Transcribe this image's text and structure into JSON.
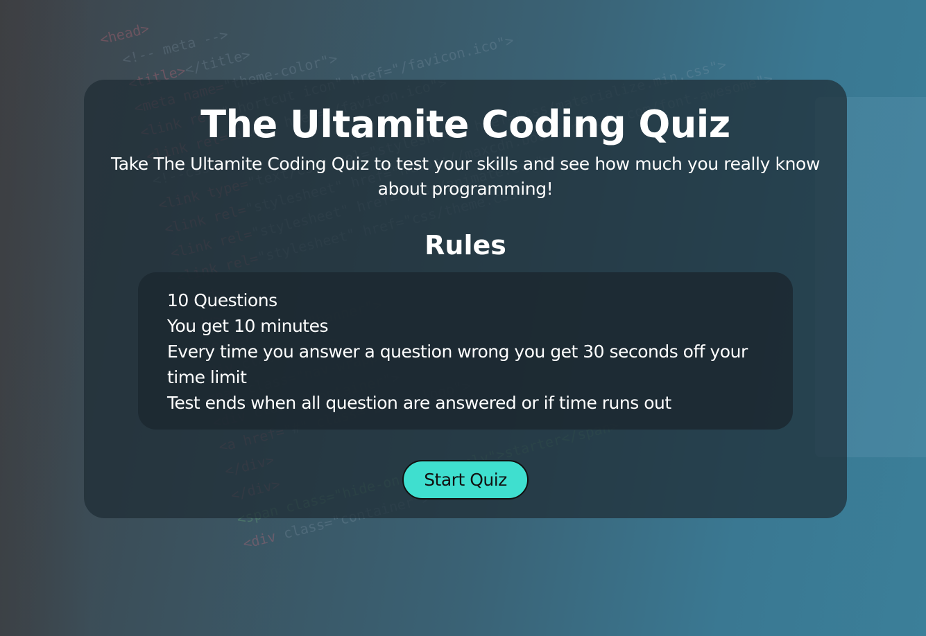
{
  "header": {
    "title": "The Ultamite Coding Quiz",
    "subtitle": "Take The Ultamite Coding Quiz to test your skills and see how much you really know about programming!"
  },
  "rules": {
    "heading": "Rules",
    "items": [
      "10 Questions",
      "You get 10 minutes",
      "Every time you answer a question wrong you get 30 seconds off your time limit",
      "Test ends when all question are answered or if time runs out"
    ]
  },
  "actions": {
    "start_label": "Start Quiz"
  },
  "colors": {
    "card_background": "#1e2c34",
    "button_background": "#3fdfcf",
    "text": "#ffffff"
  }
}
